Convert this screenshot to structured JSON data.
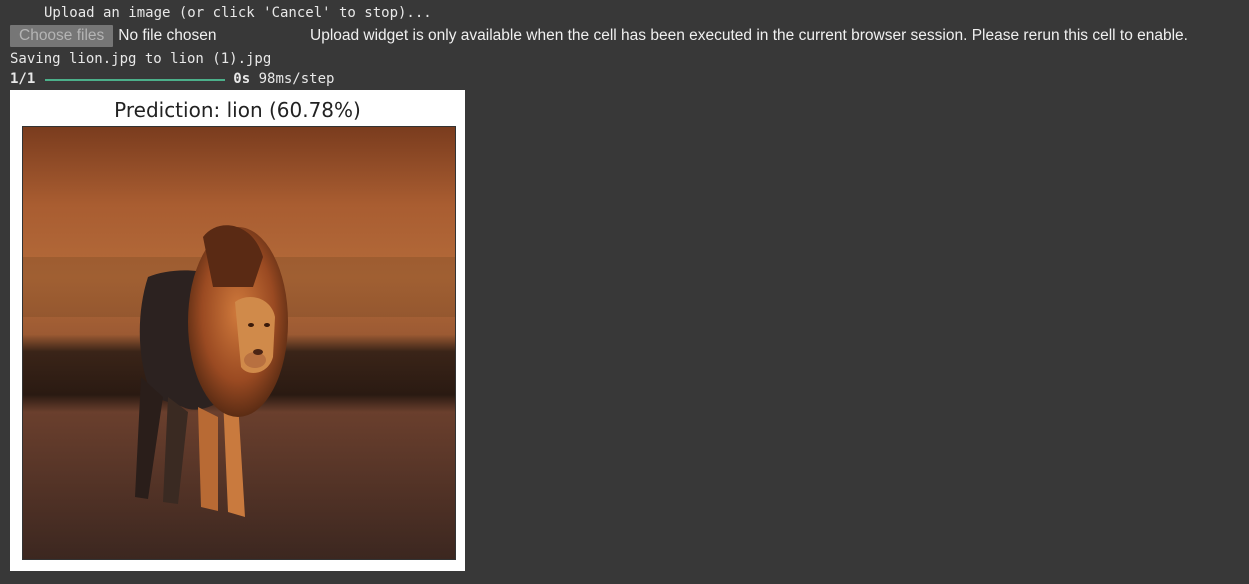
{
  "upload_prompt": "Upload an image (or click 'Cancel' to stop)...",
  "widget": {
    "choose_files_label": "Choose files",
    "no_file_text": "No file chosen",
    "note": "Upload widget is only available when the cell has been executed in the current browser session. Please rerun this cell to enable."
  },
  "saving_text": "Saving lion.jpg to lion (1).jpg",
  "progress": {
    "step_count": "1/1",
    "fraction": 1.0,
    "elapsed": "0s",
    "per_step": "98ms/step"
  },
  "figure": {
    "title": "Prediction: lion (60.78%)"
  },
  "colors": {
    "background": "#383838",
    "progress_bar": "#4cb08a"
  },
  "icons": {
    "upload": "upload-icon"
  }
}
